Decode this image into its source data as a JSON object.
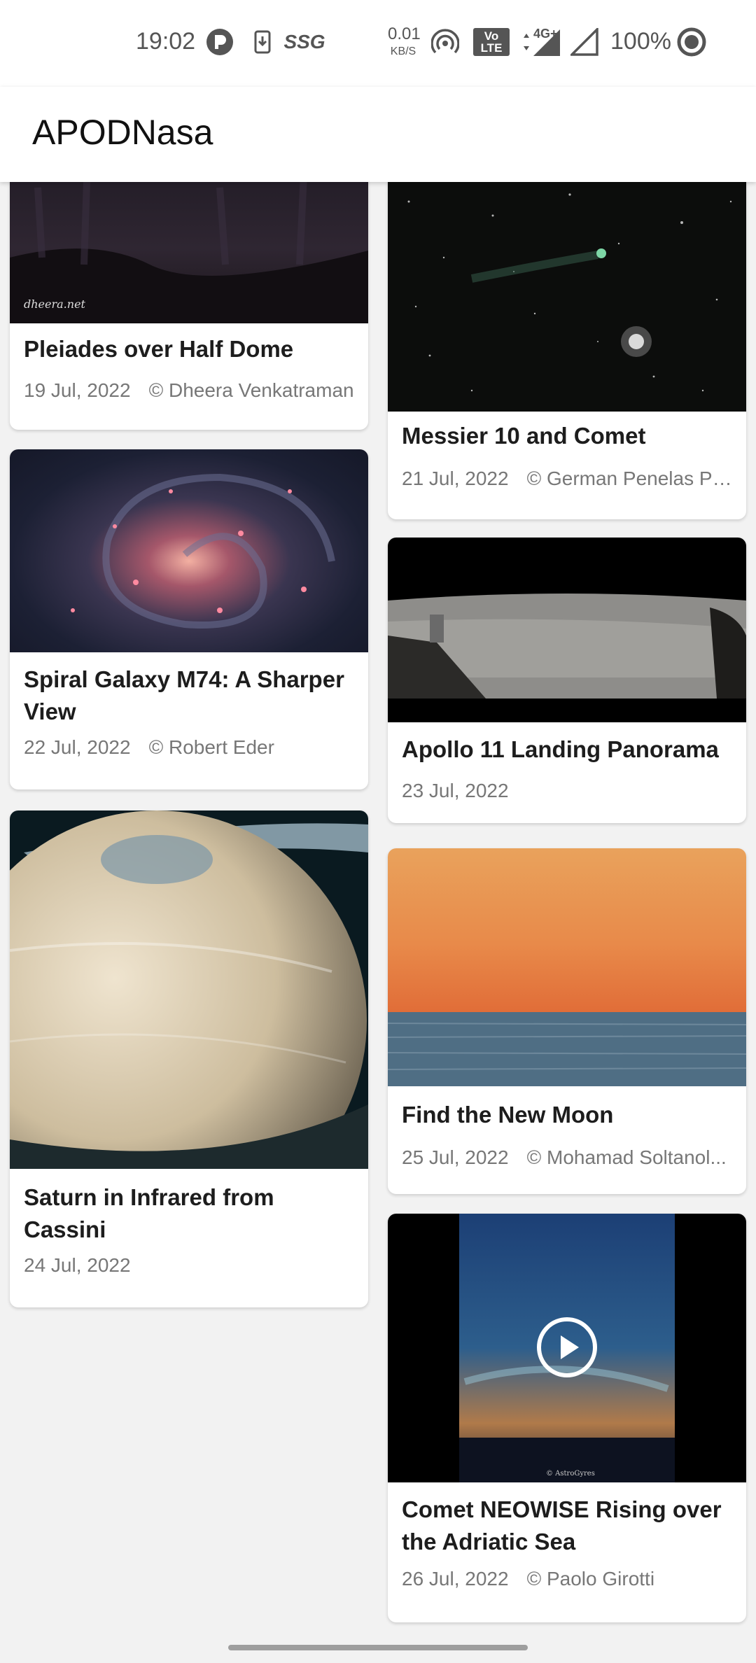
{
  "status_bar": {
    "time": "19:02",
    "net_speed_value": "0.01",
    "net_speed_unit": "KB/S",
    "volte_label": "Vo LTE",
    "network_label": "4G+",
    "battery": "100%",
    "icons": [
      "notification-p-icon",
      "download-icon",
      "ssg-icon",
      "hotspot-icon",
      "volte-icon",
      "signal-icon",
      "signal-empty-icon",
      "battery-ring-icon"
    ],
    "ssg_label": "SSG"
  },
  "app_bar": {
    "title": "APODNasa"
  },
  "cards": [
    {
      "title": "Pleiades over Half Dome",
      "date": "19 Jul, 2022",
      "copyright": "© Dheera Venkatraman",
      "watermark": "dheera.net"
    },
    {
      "title": "Messier 10 and Comet",
      "date": "21 Jul, 2022",
      "copyright": "© German Penelas Pe..."
    },
    {
      "title": "Spiral Galaxy M74: A Sharper View",
      "date": "22 Jul, 2022",
      "copyright": "© Robert Eder"
    },
    {
      "title": "Apollo 11 Landing Panorama",
      "date": "23 Jul, 2022",
      "copyright": ""
    },
    {
      "title": "Saturn in Infrared from Cassini",
      "date": "24 Jul, 2022",
      "copyright": ""
    },
    {
      "title": "Find the New Moon",
      "date": "25 Jul, 2022",
      "copyright": "© Mohamad Soltanol..."
    },
    {
      "title": "Comet NEOWISE Rising over the Adriatic Sea",
      "date": "26 Jul, 2022",
      "copyright": "© Paolo Girotti",
      "watermark": "© AstroGyres"
    }
  ],
  "colors": {
    "background": "#f2f2f2",
    "card": "#ffffff",
    "title_text": "#1d1d1d",
    "meta_text": "#777777"
  }
}
